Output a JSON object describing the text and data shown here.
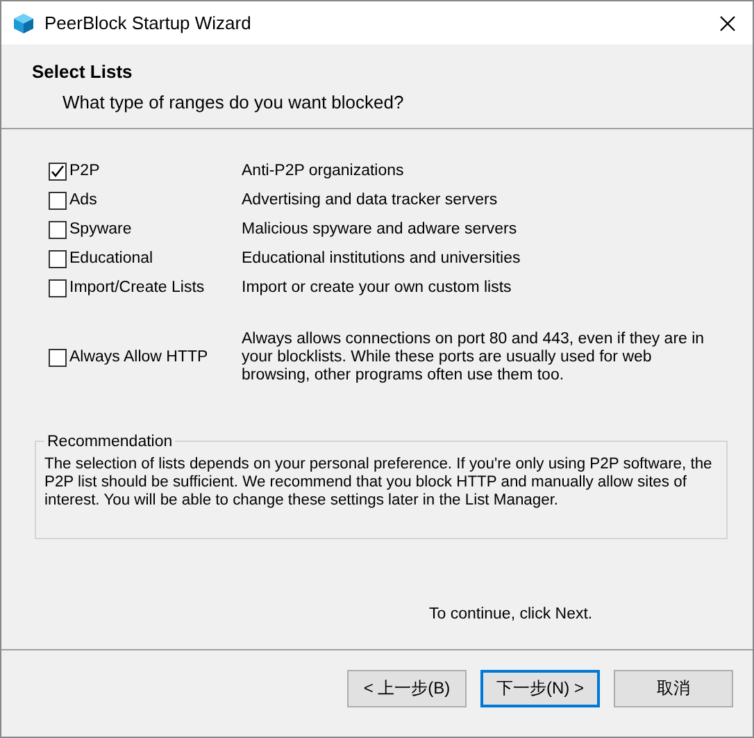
{
  "window": {
    "title": "PeerBlock Startup Wizard"
  },
  "header": {
    "title": "Select Lists",
    "subtitle": "What type of ranges do you want blocked?"
  },
  "lists": [
    {
      "label": "P2P",
      "description": "Anti-P2P organizations",
      "checked": true
    },
    {
      "label": "Ads",
      "description": "Advertising and data tracker servers",
      "checked": false
    },
    {
      "label": "Spyware",
      "description": "Malicious spyware and adware servers",
      "checked": false
    },
    {
      "label": "Educational",
      "description": "Educational institutions and universities",
      "checked": false
    },
    {
      "label": "Import/Create Lists",
      "description": "Import or create your own custom lists",
      "checked": false
    }
  ],
  "http": {
    "label": "Always Allow HTTP",
    "description": "Always allows connections on port 80 and 443, even if they are in your blocklists.  While these ports are usually used for web browsing, other programs often use them too.",
    "checked": false
  },
  "recommendation": {
    "title": "Recommendation",
    "text": "The selection of lists depends on your personal preference.  If you're only using P2P software, the P2P list should be sufficient.  We recommend that you block HTTP and manually allow sites of interest.  You will be able to change these settings later in the List Manager."
  },
  "hint": "To continue, click Next.",
  "buttons": [
    {
      "label": "< 上一步(B)",
      "default": false
    },
    {
      "label": "下一步(N) >",
      "default": true
    },
    {
      "label": "取消",
      "default": false
    }
  ]
}
